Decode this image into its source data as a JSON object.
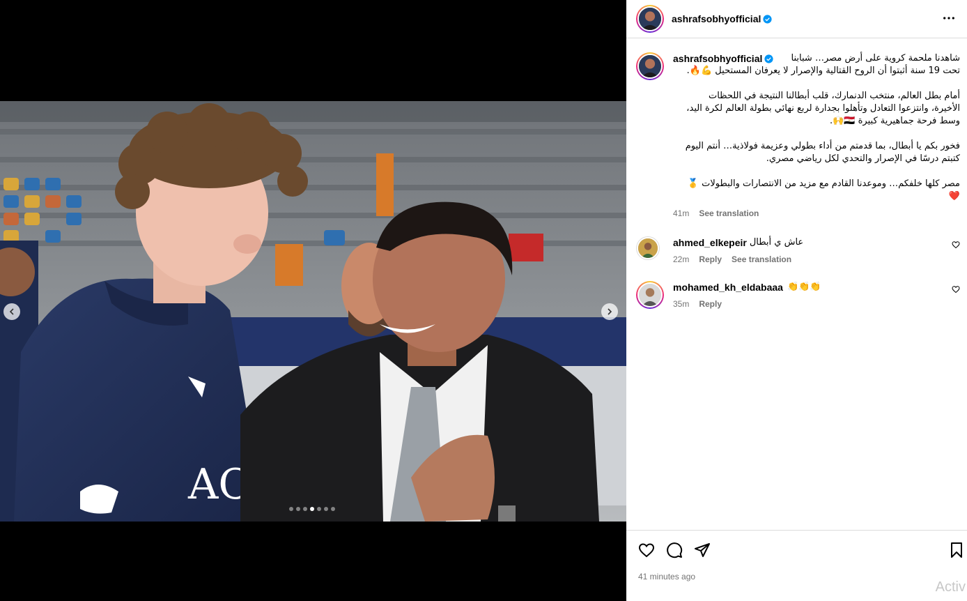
{
  "post": {
    "username": "ashrafsobhyofficial",
    "caption_lines": [
      "شاهدنا ملحمة كروية على أرض مصر… شبابنا",
      "تحت 19 سنة أثبتوا أن الروح القتالية والإصرار لا يعرفان المستحيل 💪🔥.",
      "",
      "أمام بطل العالم، منتخب الدنمارك، قلب أبطالنا النتيجة في اللحظات",
      "الأخيرة، وانتزعوا التعادل وتأهلوا بجدارة لربع نهائي بطولة العالم لكرة اليد،",
      "وسط فرحة جماهيرية كبيرة 🇪🇬🙌.",
      "",
      "فخور بكم يا أبطال، بما قدمتم من أداء بطولي وعزيمة فولاذية… أنتم اليوم",
      "كتبتم درسًا في الإصرار والتحدي لكل رياضي مصري.",
      "",
      "مصر كلها خلفكم… وموعدنا القادم مع مزيد من الانتصارات والبطولات 🥇",
      "❤️"
    ],
    "caption_time": "41m",
    "see_translation": "See translation",
    "time_ago": "41 minutes ago"
  },
  "comments": [
    {
      "username": "ahmed_elkepeir",
      "text": "عاش ي أبطال",
      "time": "22m",
      "reply": "Reply",
      "see_translation": "See translation"
    },
    {
      "username": "mohamed_kh_eldabaaa",
      "text": "👏👏👏",
      "time": "35m",
      "reply": "Reply"
    }
  ],
  "carousel": {
    "total": 7,
    "active_index": 3
  },
  "icons": {
    "more": "more-horizontal-icon",
    "like": "heart-icon",
    "comment": "comment-icon",
    "share": "send-icon",
    "save": "bookmark-icon",
    "verified": "verified-badge-icon",
    "prev": "chevron-left-icon",
    "next": "chevron-right-icon"
  },
  "colors": {
    "verified": "#0095f6",
    "meta_text": "#737373",
    "border": "#dbdbdb"
  },
  "overlay": {
    "activate_text": "Activ"
  }
}
